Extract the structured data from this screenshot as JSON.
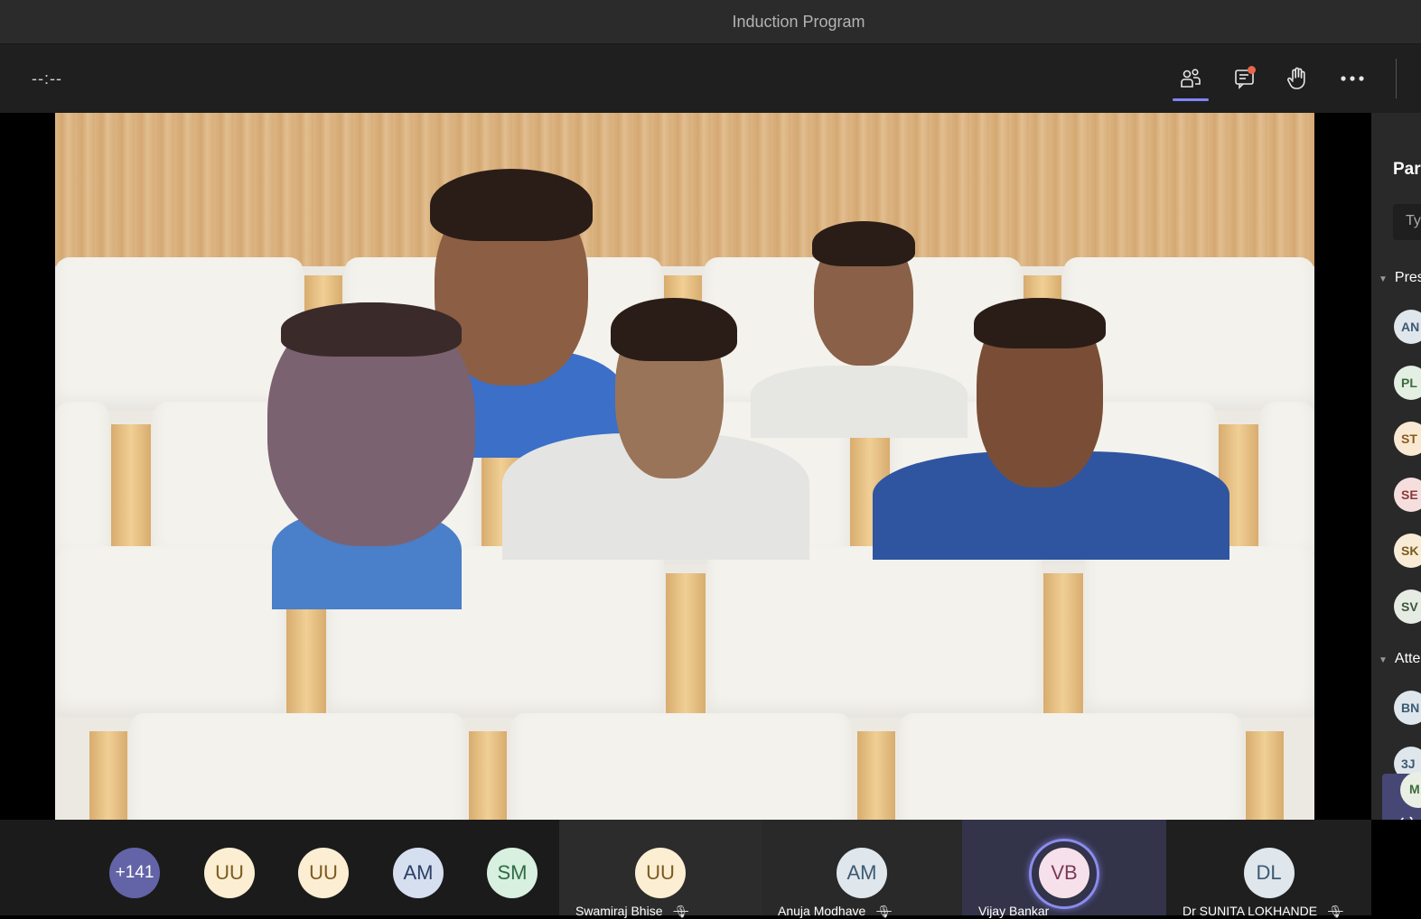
{
  "window": {
    "title": "Induction Program"
  },
  "toolbar": {
    "timer": "--:--",
    "buttons": [
      {
        "name": "participants",
        "icon": "people-icon",
        "active": true
      },
      {
        "name": "chat",
        "icon": "chat-icon",
        "has_notification": true
      },
      {
        "name": "raise-hand",
        "icon": "hand-icon"
      },
      {
        "name": "more-actions",
        "icon": "ellipsis-icon"
      }
    ]
  },
  "side_panel": {
    "title": "Par",
    "search_placeholder": "Ty",
    "sections": [
      {
        "label": "Pres",
        "avatars": [
          {
            "initials": "AN",
            "bg": "#dfe6ec",
            "fg": "#3b5a73"
          },
          {
            "initials": "PL",
            "bg": "#e3efe3",
            "fg": "#3d6b3d"
          },
          {
            "initials": "ST",
            "bg": "#f9e9d3",
            "fg": "#8a5a1e"
          },
          {
            "initials": "SE",
            "bg": "#f6dede",
            "fg": "#8a3a3a"
          },
          {
            "initials": "SK",
            "bg": "#f9ecd7",
            "fg": "#7a5a1e"
          },
          {
            "initials": "SV",
            "bg": "#e6ece3",
            "fg": "#3d553d"
          }
        ]
      },
      {
        "label": "Atte",
        "avatars": [
          {
            "initials": "BN",
            "bg": "#dfe6ec",
            "fg": "#3b5a73"
          },
          {
            "initials": "3J",
            "bg": "#dfe6ec",
            "fg": "#3b5a73"
          }
        ]
      }
    ],
    "callout_initial": "M"
  },
  "participant_strip": {
    "overflow": {
      "label": "+141",
      "bg": "#6264a7",
      "fg": "#ffffff"
    },
    "small_avatars": [
      {
        "initials": "UU",
        "bg": "#fbeed2",
        "fg": "#7d5a1e"
      },
      {
        "initials": "UU",
        "bg": "#fbeed2",
        "fg": "#7d5a1e"
      },
      {
        "initials": "AM",
        "bg": "#d6dff0",
        "fg": "#2c3e66"
      },
      {
        "initials": "SM",
        "bg": "#d7f0df",
        "fg": "#2f6b45"
      }
    ],
    "tiles": [
      {
        "initials": "UU",
        "name": "Swamiraj Bhise",
        "muted": true,
        "speaking": false,
        "bg": "#fbeed2",
        "fg": "#7d5a1e",
        "tile_bg": "#2d2c2c"
      },
      {
        "initials": "AM",
        "name": "Anuja Modhave",
        "muted": true,
        "speaking": false,
        "bg": "#dfe6ec",
        "fg": "#3b5a73",
        "tile_bg": "#292929"
      },
      {
        "initials": "VB",
        "name": "Vijay Bankar",
        "muted": false,
        "speaking": true,
        "bg": "#f6e1ea",
        "fg": "#7a3a55",
        "tile_bg": "#33334a"
      },
      {
        "initials": "DL",
        "name": "Dr SUNITA LOKHANDE",
        "muted": true,
        "speaking": false,
        "bg": "#dfe6ec",
        "fg": "#3b5a73",
        "tile_bg": "#1f1f1f"
      }
    ]
  }
}
